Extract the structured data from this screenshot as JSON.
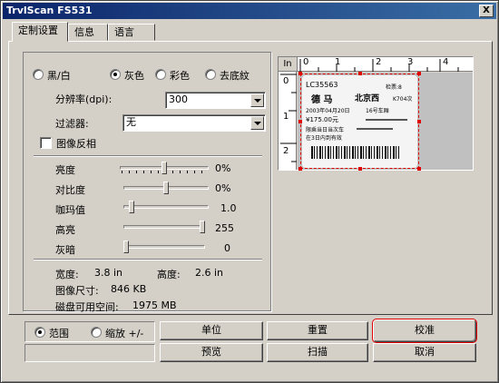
{
  "window": {
    "title": "TrvlScan FS531",
    "close": "X"
  },
  "tabs": [
    {
      "label": "定制设置",
      "active": true
    },
    {
      "label": "信息"
    },
    {
      "label": "语言"
    }
  ],
  "color_mode": {
    "options": [
      "黑/白",
      "灰色",
      "彩色",
      "去底紋"
    ],
    "selected": "灰色"
  },
  "resolution": {
    "label": "分辨率(dpi):",
    "value": "300"
  },
  "filter": {
    "label": "过滤器:",
    "value": "无"
  },
  "invert": {
    "label": "图像反相",
    "checked": false
  },
  "adjustments": [
    {
      "label": "亮度",
      "value": "0%",
      "level": 0.5
    },
    {
      "label": "对比度",
      "value": "0%",
      "level": 0.5
    },
    {
      "label": "咖玛值",
      "value": "1.0",
      "level": 0.1
    },
    {
      "label": "高亮",
      "value": "255",
      "level": 1.0
    },
    {
      "label": "灰暗",
      "value": "0",
      "level": 0.0
    }
  ],
  "info": {
    "width_label": "宽度:",
    "width_value": "3.8 in",
    "height_label": "高度:",
    "height_value": "2.6 in",
    "size_label": "图像尺寸:",
    "size_value": "846 KB",
    "disk_label": "磁盘可用空间:",
    "disk_value": "1975 MB"
  },
  "preview": {
    "unit": "In",
    "h_ticks": [
      "0",
      "1",
      "2",
      "3",
      "4"
    ],
    "v_ticks": [
      "0",
      "1",
      "2"
    ],
    "ticket_text": {
      "serial": "LC35563",
      "check": "检票:8",
      "from": "德 马",
      "to": "北京西",
      "train": "K704次",
      "date": "2003年04月20日",
      "seat": "16号车厢",
      "price": "¥175.00元",
      "note1": "限乘当日当次车",
      "note2": "在3日内到有效"
    },
    "colors": {
      "selection": "#e00000"
    }
  },
  "scope": {
    "options": [
      "范围",
      "缩放 +/-"
    ],
    "selected": "范围"
  },
  "buttons": {
    "unit": "单位",
    "reset": "重置",
    "calibrate": "校准",
    "preview": "预览",
    "scan": "扫描",
    "cancel": "取消"
  }
}
